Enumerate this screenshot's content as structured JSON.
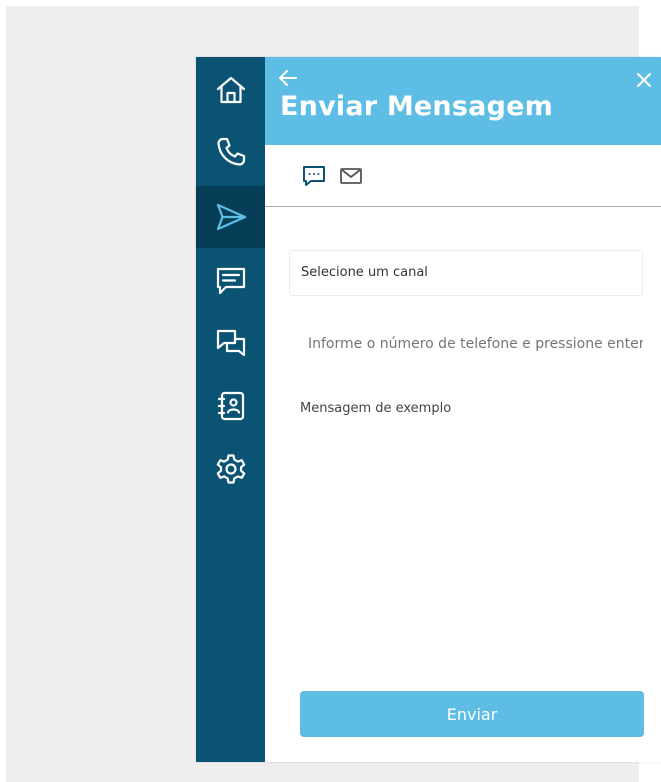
{
  "header": {
    "title": "Enviar Mensagem",
    "back_icon": "arrow-left-icon",
    "close_icon": "close-icon"
  },
  "sidebar": {
    "items": [
      {
        "icon": "home-icon",
        "active": false
      },
      {
        "icon": "phone-icon",
        "active": false
      },
      {
        "icon": "send-icon",
        "active": true
      },
      {
        "icon": "message-icon",
        "active": false
      },
      {
        "icon": "chat-icon",
        "active": false
      },
      {
        "icon": "contacts-icon",
        "active": false
      },
      {
        "icon": "gear-icon",
        "active": false
      }
    ]
  },
  "channel_tabs": [
    {
      "icon": "sms-icon",
      "active": true
    },
    {
      "icon": "email-icon",
      "active": false
    }
  ],
  "form": {
    "channel_select": "Selecione um canal",
    "phone_placeholder": "Informe o número de telefone e pressione enter",
    "message": "Mensagem de exemplo",
    "send_label": "Enviar"
  },
  "colors": {
    "sidebar": "#0b5373",
    "sidebar_active": "#063e57",
    "header": "#5ebde5",
    "button": "#5ebde5"
  }
}
